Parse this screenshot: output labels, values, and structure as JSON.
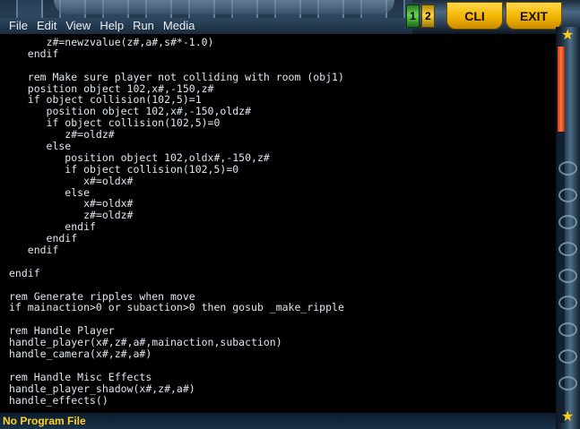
{
  "menu": {
    "items": [
      "File",
      "Edit",
      "View",
      "Help",
      "Run",
      "Media"
    ]
  },
  "toolbar": {
    "btn1_label": "1",
    "btn2_label": "2",
    "cli_label": "CLI",
    "exit_label": "EXIT"
  },
  "editor": {
    "lines": [
      "      z#=newzvalue(z#,a#,s#*-1.0)",
      "   endif",
      "",
      "   rem Make sure player not colliding with room (obj1)",
      "   position object 102,x#,-150,z#",
      "   if object collision(102,5)=1",
      "      position object 102,x#,-150,oldz#",
      "      if object collision(102,5)=0",
      "         z#=oldz#",
      "      else",
      "         position object 102,oldx#,-150,z#",
      "         if object collision(102,5)=0",
      "            x#=oldx#",
      "         else",
      "            x#=oldx#",
      "            z#=oldz#",
      "         endif",
      "      endif",
      "   endif",
      "",
      "endif",
      "",
      "rem Generate ripples when move",
      "if mainaction>0 or subaction>0 then gosub _make_ripple",
      "",
      "rem Handle Player",
      "handle_player(x#,z#,a#,mainaction,subaction)",
      "handle_camera(x#,z#,a#)",
      "",
      "rem Handle Misc Effects",
      "handle_player_shadow(x#,z#,a#)",
      "handle_effects()"
    ]
  },
  "status": {
    "text": "No Program File"
  },
  "colors": {
    "accent_yellow": "#ffd21f",
    "code_text": "#dde6ee",
    "background": "#000000"
  }
}
